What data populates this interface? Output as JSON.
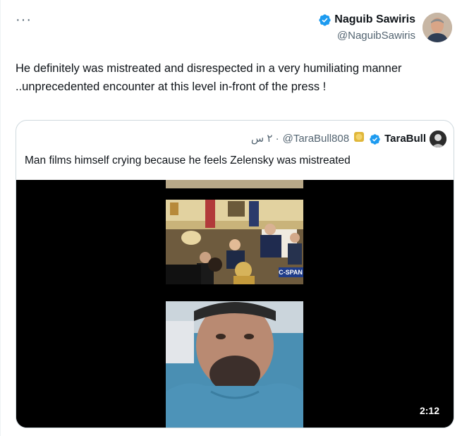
{
  "tweet": {
    "more_label": "···",
    "author_name": "Naguib Sawiris",
    "author_handle": "@NaguibSawiris",
    "text_line1": "He definitely was mistreated and disrespected in a very humiliating manner",
    "text_line2": "..unprecedented encounter at this level in-front of the press !"
  },
  "quote": {
    "author_name": "TaraBull",
    "author_handle": "@TaraBull808",
    "time": "٢ س ·",
    "text": "Man films himself crying because he feels Zelensky was mistreated",
    "video": {
      "top_caption": "C-SPAN",
      "duration": "2:12"
    }
  },
  "colors": {
    "verified": "#1d9bf0",
    "text": "#0f1419",
    "secondary": "#536471",
    "border": "#cfd9de"
  }
}
